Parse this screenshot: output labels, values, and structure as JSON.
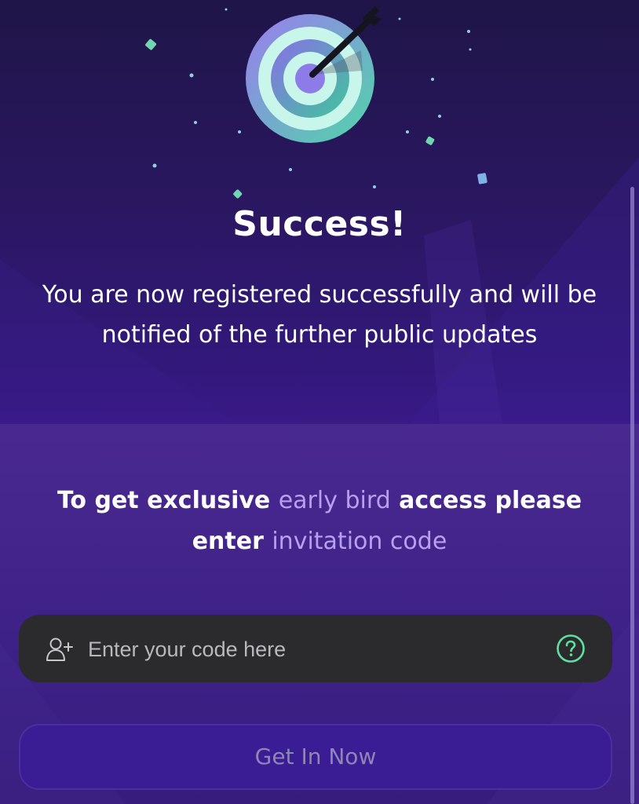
{
  "hero": {
    "title": "Success!",
    "message": "You are now registered successfully and will be notified of the further public updates",
    "icon": "target-arrow-icon"
  },
  "invite": {
    "prompt_part1": "To get exclusive ",
    "prompt_highlight1": "early bird",
    "prompt_part2": " access please enter ",
    "prompt_highlight2": "invitation code",
    "code_placeholder": "Enter your code here",
    "code_value": "",
    "field_icon": "user-plus-icon",
    "help_icon": "help-circle-icon",
    "button_label": "Get In Now"
  },
  "colors": {
    "background_top": "#1f1548",
    "background_bottom": "#3b1a8a",
    "highlight_text": "#b8a0f0",
    "field_background": "#2b2b2d",
    "help_icon": "#5ee0a0",
    "button_background": "#3a1c94",
    "button_text": "#8f86b6"
  }
}
